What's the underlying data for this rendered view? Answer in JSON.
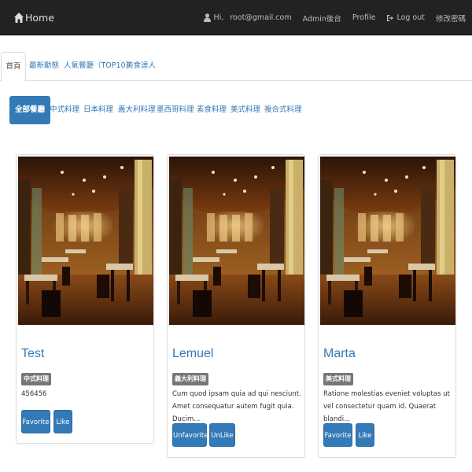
{
  "navbar": {
    "brand": "Home",
    "greeting": "Hi,",
    "email": "root@gmail.com",
    "admin": "Admin後台",
    "profile": "Profile",
    "logout": "Log out",
    "change_password": "修改密碼"
  },
  "tabs": [
    {
      "label": "首頁",
      "active": true
    },
    {
      "label": "最新動態"
    },
    {
      "label": "人氣餐廳（TOP10）"
    },
    {
      "label": "美食達人"
    }
  ],
  "categories": [
    {
      "label": "全部餐廳",
      "active": true
    },
    {
      "label": "中式料理"
    },
    {
      "label": "日本料理"
    },
    {
      "label": "義大利料理"
    },
    {
      "label": "墨西哥料理"
    },
    {
      "label": "素食料理"
    },
    {
      "label": "美式料理"
    },
    {
      "label": "複合式料理"
    }
  ],
  "restaurants": [
    {
      "name": "Test",
      "category": "中式料理",
      "description": "456456",
      "favorite_label": "Favorite",
      "like_label": "Like"
    },
    {
      "name": "Lemuel",
      "category": "義大利料理",
      "description": "Cum quod ipsam quia ad qui nesciunt. Amet consequatur autem fugit quia. Ducim...",
      "favorite_label": "Unfavorite",
      "like_label": "UnLike"
    },
    {
      "name": "Marta",
      "category": "美式料理",
      "description": "Ratione molestias eveniet voluptas ut vel consectetur quam id. Quaerat blandi...",
      "favorite_label": "Favorite",
      "like_label": "Like"
    }
  ],
  "colors": {
    "navbar": "#222222",
    "primary": "#337ab7",
    "badge": "#777777"
  }
}
